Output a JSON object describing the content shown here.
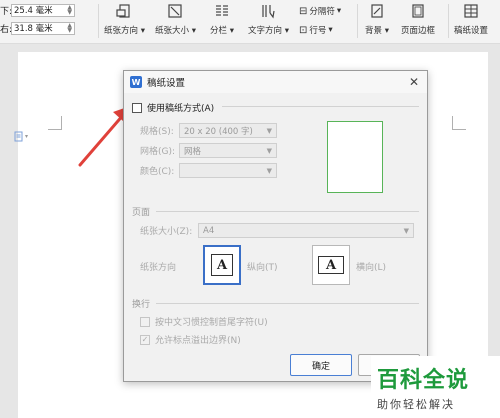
{
  "ribbon": {
    "margin_bottom": {
      "label": "下:",
      "value": "25.4 毫米"
    },
    "margin_right": {
      "label": "右:",
      "value": "31.8 毫米"
    },
    "buttons": {
      "orientation": "纸张方向",
      "size": "纸张大小",
      "columns": "分栏",
      "text_direction": "文字方向",
      "breaks": "分隔符",
      "line_numbers": "行号",
      "background": "背景",
      "page_border": "页面边框",
      "manuscript": "稿纸设置"
    }
  },
  "dialog": {
    "title": "稿纸设置",
    "use_manuscript_label": "使用稿纸方式(A)",
    "spec": {
      "label": "规格(S):",
      "value": "20 x 20 (400 字)"
    },
    "grid": {
      "label": "网格(G):",
      "value": "网格"
    },
    "color": {
      "label": "颜色(C):",
      "value": ""
    },
    "page_group": "页面",
    "paper_size": {
      "label": "纸张大小(Z):",
      "value": "A4"
    },
    "orientation_label": "纸张方向",
    "portrait_label": "纵向(T)",
    "landscape_label": "横向(L)",
    "portrait_glyph": "A",
    "landscape_glyph": "A",
    "wrap_group": "换行",
    "opt_cjk_control": "按中文习惯控制首尾字符(U)",
    "opt_allow_punct": "允许标点溢出边界(N)",
    "ok_label": "确定"
  },
  "watermark": {
    "big": "百科全说",
    "small": "助你轻松解决"
  },
  "colors": {
    "accent": "#3a6fc7",
    "brand": "#1e9a3c",
    "arrow": "#e0413a",
    "preview": "#58b458"
  }
}
